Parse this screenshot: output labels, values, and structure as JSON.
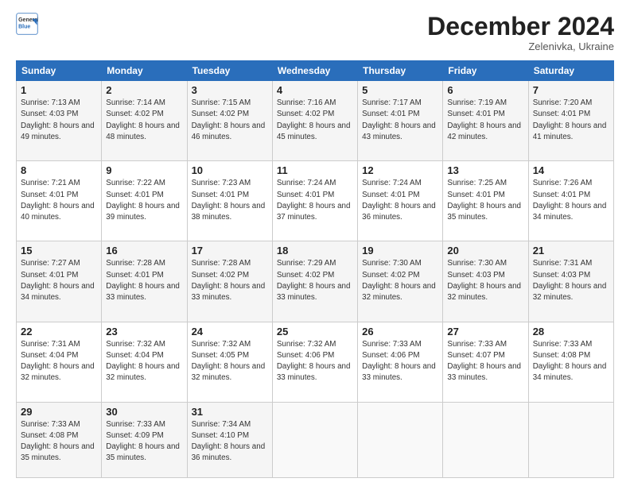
{
  "header": {
    "logo_line1": "General",
    "logo_line2": "Blue",
    "month": "December 2024",
    "location": "Zelenivka, Ukraine"
  },
  "weekdays": [
    "Sunday",
    "Monday",
    "Tuesday",
    "Wednesday",
    "Thursday",
    "Friday",
    "Saturday"
  ],
  "weeks": [
    [
      {
        "day": "1",
        "sunrise": "7:13 AM",
        "sunset": "4:03 PM",
        "daylight": "8 hours and 49 minutes."
      },
      {
        "day": "2",
        "sunrise": "7:14 AM",
        "sunset": "4:02 PM",
        "daylight": "8 hours and 48 minutes."
      },
      {
        "day": "3",
        "sunrise": "7:15 AM",
        "sunset": "4:02 PM",
        "daylight": "8 hours and 46 minutes."
      },
      {
        "day": "4",
        "sunrise": "7:16 AM",
        "sunset": "4:02 PM",
        "daylight": "8 hours and 45 minutes."
      },
      {
        "day": "5",
        "sunrise": "7:17 AM",
        "sunset": "4:01 PM",
        "daylight": "8 hours and 43 minutes."
      },
      {
        "day": "6",
        "sunrise": "7:19 AM",
        "sunset": "4:01 PM",
        "daylight": "8 hours and 42 minutes."
      },
      {
        "day": "7",
        "sunrise": "7:20 AM",
        "sunset": "4:01 PM",
        "daylight": "8 hours and 41 minutes."
      }
    ],
    [
      {
        "day": "8",
        "sunrise": "7:21 AM",
        "sunset": "4:01 PM",
        "daylight": "8 hours and 40 minutes."
      },
      {
        "day": "9",
        "sunrise": "7:22 AM",
        "sunset": "4:01 PM",
        "daylight": "8 hours and 39 minutes."
      },
      {
        "day": "10",
        "sunrise": "7:23 AM",
        "sunset": "4:01 PM",
        "daylight": "8 hours and 38 minutes."
      },
      {
        "day": "11",
        "sunrise": "7:24 AM",
        "sunset": "4:01 PM",
        "daylight": "8 hours and 37 minutes."
      },
      {
        "day": "12",
        "sunrise": "7:24 AM",
        "sunset": "4:01 PM",
        "daylight": "8 hours and 36 minutes."
      },
      {
        "day": "13",
        "sunrise": "7:25 AM",
        "sunset": "4:01 PM",
        "daylight": "8 hours and 35 minutes."
      },
      {
        "day": "14",
        "sunrise": "7:26 AM",
        "sunset": "4:01 PM",
        "daylight": "8 hours and 34 minutes."
      }
    ],
    [
      {
        "day": "15",
        "sunrise": "7:27 AM",
        "sunset": "4:01 PM",
        "daylight": "8 hours and 34 minutes."
      },
      {
        "day": "16",
        "sunrise": "7:28 AM",
        "sunset": "4:01 PM",
        "daylight": "8 hours and 33 minutes."
      },
      {
        "day": "17",
        "sunrise": "7:28 AM",
        "sunset": "4:02 PM",
        "daylight": "8 hours and 33 minutes."
      },
      {
        "day": "18",
        "sunrise": "7:29 AM",
        "sunset": "4:02 PM",
        "daylight": "8 hours and 33 minutes."
      },
      {
        "day": "19",
        "sunrise": "7:30 AM",
        "sunset": "4:02 PM",
        "daylight": "8 hours and 32 minutes."
      },
      {
        "day": "20",
        "sunrise": "7:30 AM",
        "sunset": "4:03 PM",
        "daylight": "8 hours and 32 minutes."
      },
      {
        "day": "21",
        "sunrise": "7:31 AM",
        "sunset": "4:03 PM",
        "daylight": "8 hours and 32 minutes."
      }
    ],
    [
      {
        "day": "22",
        "sunrise": "7:31 AM",
        "sunset": "4:04 PM",
        "daylight": "8 hours and 32 minutes."
      },
      {
        "day": "23",
        "sunrise": "7:32 AM",
        "sunset": "4:04 PM",
        "daylight": "8 hours and 32 minutes."
      },
      {
        "day": "24",
        "sunrise": "7:32 AM",
        "sunset": "4:05 PM",
        "daylight": "8 hours and 32 minutes."
      },
      {
        "day": "25",
        "sunrise": "7:32 AM",
        "sunset": "4:06 PM",
        "daylight": "8 hours and 33 minutes."
      },
      {
        "day": "26",
        "sunrise": "7:33 AM",
        "sunset": "4:06 PM",
        "daylight": "8 hours and 33 minutes."
      },
      {
        "day": "27",
        "sunrise": "7:33 AM",
        "sunset": "4:07 PM",
        "daylight": "8 hours and 33 minutes."
      },
      {
        "day": "28",
        "sunrise": "7:33 AM",
        "sunset": "4:08 PM",
        "daylight": "8 hours and 34 minutes."
      }
    ],
    [
      {
        "day": "29",
        "sunrise": "7:33 AM",
        "sunset": "4:08 PM",
        "daylight": "8 hours and 35 minutes."
      },
      {
        "day": "30",
        "sunrise": "7:33 AM",
        "sunset": "4:09 PM",
        "daylight": "8 hours and 35 minutes."
      },
      {
        "day": "31",
        "sunrise": "7:34 AM",
        "sunset": "4:10 PM",
        "daylight": "8 hours and 36 minutes."
      },
      null,
      null,
      null,
      null
    ]
  ]
}
